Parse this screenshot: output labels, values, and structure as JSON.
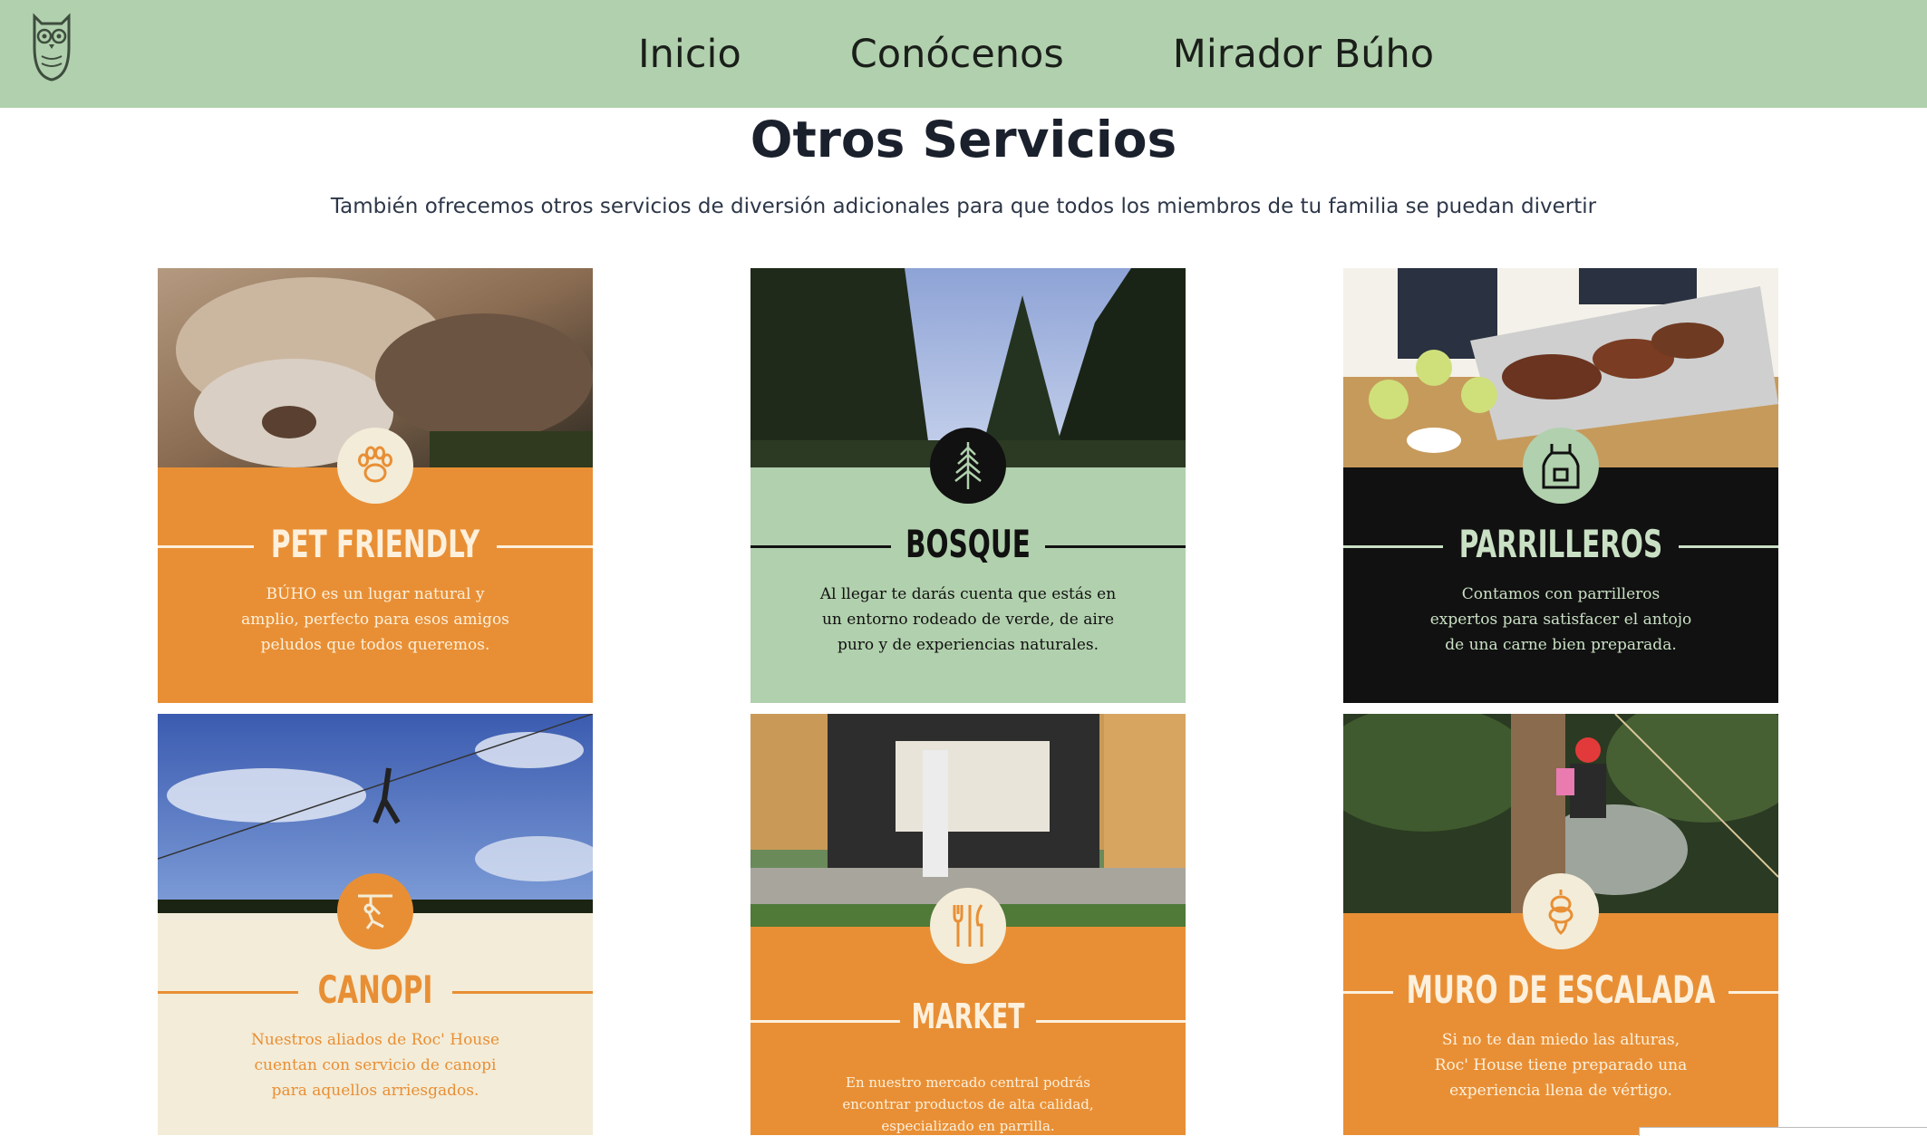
{
  "nav": {
    "logo_icon": "owl-icon",
    "items": [
      "Inicio",
      "Conócenos",
      "Mirador Búho"
    ]
  },
  "section": {
    "title": "Otros Servicios",
    "subtitle": "También ofrecemos otros servicios de diversión adicionales para que todos los miembros de tu familia se puedan divertir"
  },
  "cards": [
    {
      "title": "PET FRIENDLY",
      "icon": "paw-icon",
      "lines": [
        "BÚHO es un lugar natural y",
        "amplio, perfecto para esos amigos",
        "peludos que todos queremos."
      ],
      "panel_color": "#e88f35",
      "text_color": "#fdf0dc",
      "badge_color": "#f3ecd8",
      "icon_color": "#e88f35"
    },
    {
      "title": "BOSQUE",
      "icon": "pine-tree-icon",
      "lines": [
        "Al llegar te darás cuenta que estás en",
        "un entorno rodeado de verde, de aire",
        "puro y de experiencias naturales."
      ],
      "panel_color": "#b1d0ad",
      "text_color": "#111111",
      "badge_color": "#111111",
      "icon_color": "#b1d0ad"
    },
    {
      "title": "PARRILLEROS",
      "icon": "apron-icon",
      "lines": [
        "Contamos con parrilleros",
        "expertos para satisfacer el antojo",
        "de una carne bien preparada."
      ],
      "panel_color": "#111111",
      "text_color": "#c9e0c4",
      "badge_color": "#b1d0ad",
      "icon_color": "#111111"
    },
    {
      "title": "CANOPI",
      "icon": "zipline-icon",
      "lines": [
        "Nuestros aliados de Roc' House",
        "cuentan con servicio de canopi",
        "para aquellos arriesgados."
      ],
      "panel_color": "#f3ecd8",
      "text_color": "#e88f35",
      "badge_color": "#e88f35",
      "icon_color": "#f3ecd8"
    },
    {
      "title": "MARKET",
      "icon": "cutlery-icon",
      "lines": [
        "En nuestro mercado central podrás",
        "encontrar productos de alta calidad,",
        "especializado en parrilla."
      ],
      "panel_color": "#e88f35",
      "text_color": "#fdf0dc",
      "badge_color": "#f3ecd8",
      "icon_color": "#e88f35"
    },
    {
      "title": "MURO DE ESCALADA",
      "icon": "rope-icon",
      "lines": [
        "Si no te dan miedo las alturas,",
        "Roc' House tiene preparado una",
        "experiencia llena de vértigo."
      ],
      "panel_color": "#e88f35",
      "text_color": "#fdf0dc",
      "badge_color": "#f3ecd8",
      "icon_color": "#e88f35"
    }
  ]
}
